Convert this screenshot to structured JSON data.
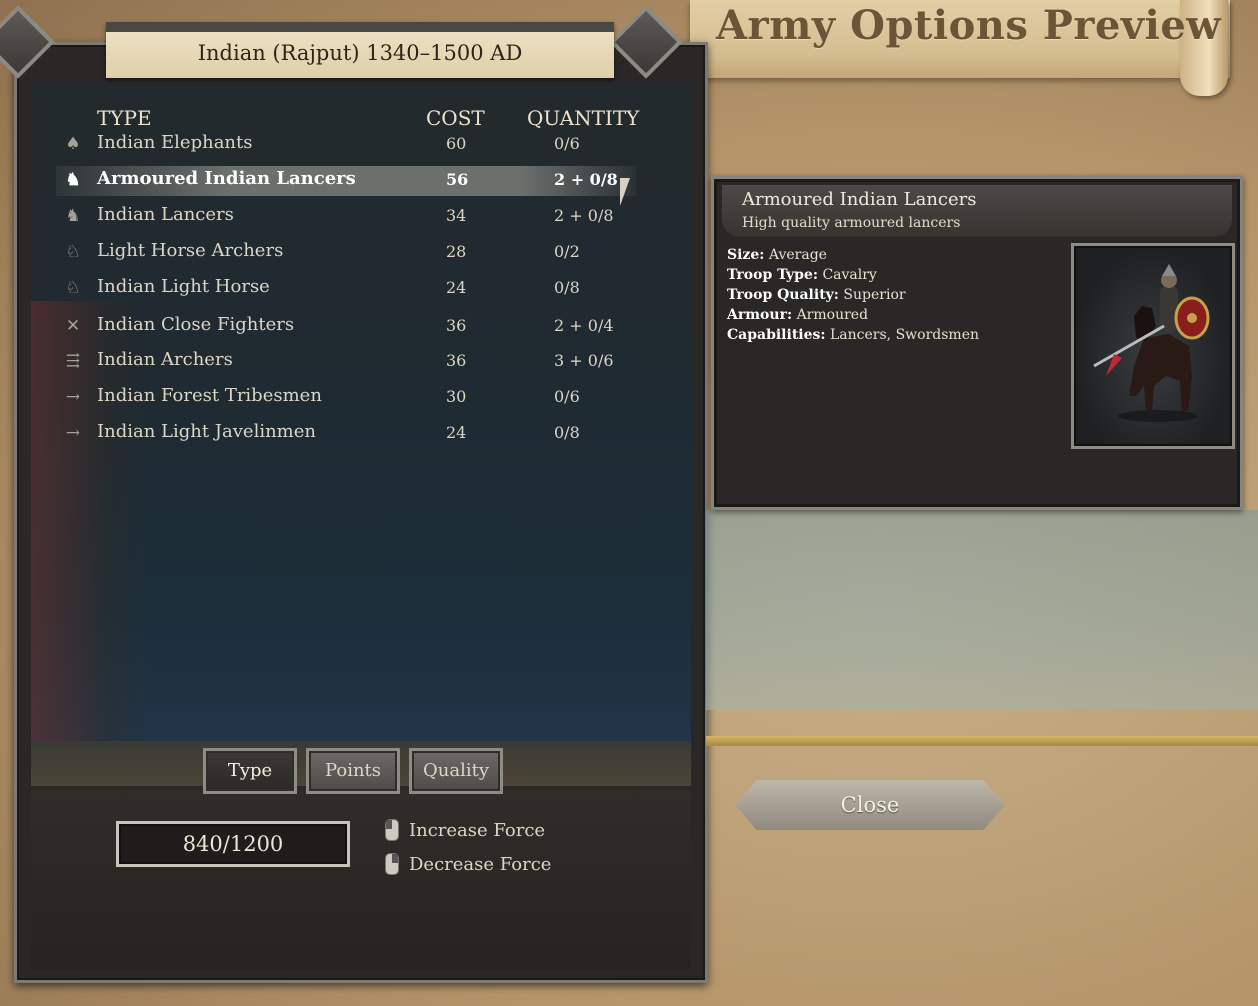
{
  "page": {
    "title": "Army Options Preview"
  },
  "army": {
    "faction_title": "Indian (Rajput) 1340–1500 AD"
  },
  "table": {
    "headers": {
      "type": "TYPE",
      "cost": "COST",
      "quantity": "QUANTITY"
    },
    "rows": [
      {
        "name": "Indian Elephants",
        "cost": "60",
        "quantity": "0/6",
        "icon": "elephant-icon",
        "glyph": "♠"
      },
      {
        "name": "Armoured Indian Lancers",
        "cost": "56",
        "quantity": "2 + 0/8",
        "icon": "horse-icon",
        "glyph": "♞",
        "selected": true
      },
      {
        "name": "Indian Lancers",
        "cost": "34",
        "quantity": "2 + 0/8",
        "icon": "horse-icon",
        "glyph": "♞"
      },
      {
        "name": "Light Horse Archers",
        "cost": "28",
        "quantity": "0/2",
        "icon": "horse-icon",
        "glyph": "♘"
      },
      {
        "name": "Indian Light Horse",
        "cost": "24",
        "quantity": "0/8",
        "icon": "horse-icon",
        "glyph": "♘"
      },
      {
        "name": "Indian Close Fighters",
        "cost": "36",
        "quantity": "2 + 0/4",
        "icon": "crossed-swords-icon",
        "glyph": "✕"
      },
      {
        "name": "Indian Archers",
        "cost": "36",
        "quantity": "3 + 0/6",
        "icon": "arrows-icon",
        "glyph": "⇶"
      },
      {
        "name": "Indian Forest Tribesmen",
        "cost": "30",
        "quantity": "0/6",
        "icon": "javelin-icon",
        "glyph": "→"
      },
      {
        "name": "Indian Light Javelinmen",
        "cost": "24",
        "quantity": "0/8",
        "icon": "javelin-icon",
        "glyph": "→"
      }
    ]
  },
  "sort": {
    "type_label": "Type",
    "points_label": "Points",
    "quality_label": "Quality",
    "active": "Type"
  },
  "points": {
    "value": "840/1200"
  },
  "force": {
    "increase_label": "Increase Force",
    "decrease_label": "Decrease Force"
  },
  "detail": {
    "name": "Armoured Indian Lancers",
    "subtitle": "High quality armoured lancers",
    "stats": [
      {
        "label": "Size:",
        "value": " Average"
      },
      {
        "label": "Troop Type:",
        "value": " Cavalry"
      },
      {
        "label": "Troop Quality:",
        "value": " Superior"
      },
      {
        "label": "Armour:",
        "value": " Armoured"
      },
      {
        "label": "Capabilities:",
        "value": " Lancers, Swordsmen"
      }
    ]
  },
  "close": {
    "label": "Close"
  },
  "colors": {
    "selected_row": "#9a9890",
    "panel_bg": "#2a2826",
    "parchment": "#dfcfa9"
  }
}
